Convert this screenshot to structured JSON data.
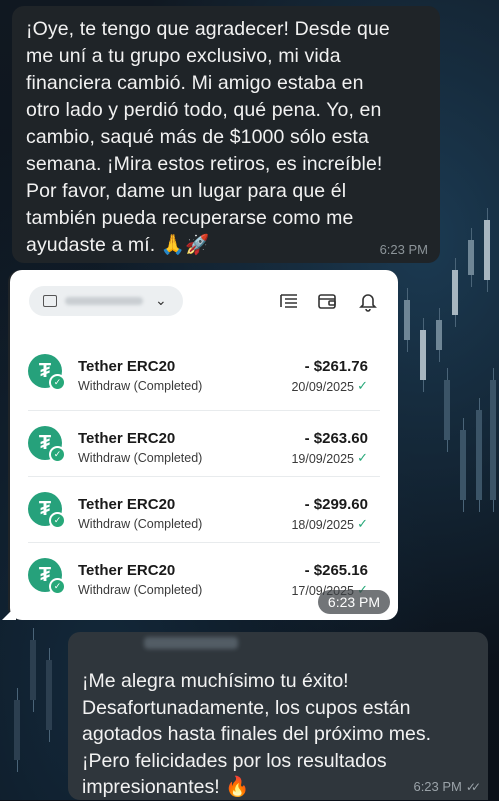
{
  "messages": {
    "incoming": {
      "text": "¡Oye, te tengo que agradecer! Desde que\nme uní a tu grupo exclusivo, mi vida\nfinanciera cambió. Mi amigo estaba en\notro lado y perdió todo, qué pena. Yo, en\ncambio, saqué más de $1000 sólo esta\nsemana. ¡Mira estos retiros, es increíble!\nPor favor, dame un lugar para que él\ntambién pueda recuperarse como me\nayudaste a mí. 🙏🚀",
      "time": "6:23 PM"
    },
    "image": {
      "time": "6:23 PM",
      "wallet_app": {
        "icons": [
          "wallet-icon",
          "chevron-down-icon",
          "list-icon",
          "wallet-card-icon",
          "bell-icon"
        ],
        "transactions": [
          {
            "name": "Tether ERC20",
            "status": "Withdraw (Completed)",
            "amount": "- $261.76",
            "date": "20/09/2025"
          },
          {
            "name": "Tether ERC20",
            "status": "Withdraw (Completed)",
            "amount": "- $263.60",
            "date": "19/09/2025"
          },
          {
            "name": "Tether ERC20",
            "status": "Withdraw (Completed)",
            "amount": "- $299.60",
            "date": "18/09/2025"
          },
          {
            "name": "Tether ERC20",
            "status": "Withdraw (Completed)",
            "amount": "- $265.16",
            "date": "17/09/2025"
          }
        ],
        "coin_symbol": "₮",
        "colors": {
          "tether_green": "#26a17b",
          "completed_green": "#27a879"
        }
      }
    },
    "outgoing": {
      "text": "¡Me alegra muchísimo tu éxito!\nDesafortunadamente, los cupos están\nagotados hasta finales del próximo mes.\n¡Pero felicidades por los resultados\nimpresionantes! 🔥",
      "time": "6:23 PM"
    }
  }
}
